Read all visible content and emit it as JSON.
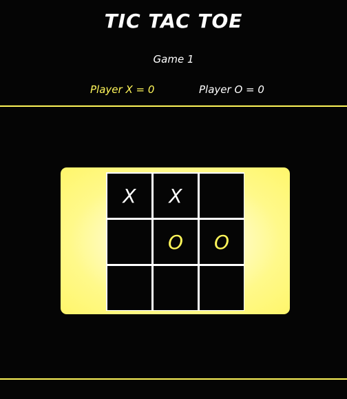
{
  "header": {
    "title": "TIC TAC TOE",
    "game_label": "Game 1"
  },
  "scoreboard": {
    "player_x": "Player X = 0",
    "player_o": "Player O = 0"
  },
  "colors": {
    "accent": "#fff65a",
    "background": "#050505",
    "text": "#ffffff"
  },
  "board": {
    "cells": [
      "X",
      "X",
      "",
      "",
      "O",
      "O",
      "",
      "",
      ""
    ]
  }
}
